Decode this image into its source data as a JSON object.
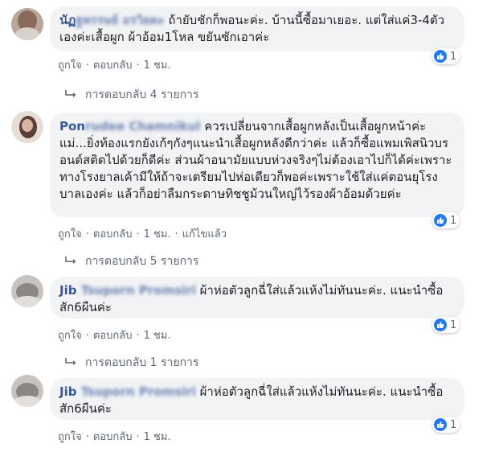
{
  "comments": [
    {
      "author_visible": "นัฏ",
      "author_blurred": "ฐพรรษย์ อรวิยดะ",
      "text": "ถ้ายับชักก็พอนะค่ะ. บ้านนี้ซื้อมาเยอะ. แต่ใส่แค่3-4ตัวเองค่ะเสื้อผูก ผ้าอ้อม1โหล ขยันซักเอาค่ะ",
      "like": "ถูกใจ",
      "reply": "ตอบกลับ",
      "time": "1 ชม.",
      "reaction_count": "1",
      "replies_label": "การตอบกลับ 4 รายการ"
    },
    {
      "author_visible": "Pon",
      "author_blurred": "rudee Chamnikul",
      "text": "ควรเปลี่ยนจากเสื้อผูกหลังเป็นเสื้อผูกหน้าค่ะแม่...ยิ่งท้องแรกยังเก้ๆกังๆแนะนำเสื้อผูกหลังดีกว่าค่ะ แล้วก็ซื้อแพมเพิสนิวบรอนต์สติดไปด้วยก็ดีค่ะ ส่วนผ้าอนามัยแบบห่วงจริงๆไม่ต้องเอาไปก็ได้ค่ะเพราะทางโรงยาลเค้ามีให้ถ้าจะเตรียมไปห่อเดียวก็พอค่ะเพราะใช้ใส่แค่ตอนยุโรงบาลเองค่ะ แล้วก็อย่าลืมกระดาษทิชชูม้วนใหญ่ไว้รองผ้าอ้อมด้วยค่ะ",
      "like": "ถูกใจ",
      "reply": "ตอบกลับ",
      "time": "1 ชม.",
      "edited": "แก้ไขแล้ว",
      "reaction_count": "1",
      "replies_label": "การตอบกลับ 5 รายการ"
    },
    {
      "author_visible": "Jib",
      "author_blurred": "Tsuporn Promsiri",
      "text": "ผ้าห่อตัวลูกฉี่ใส่แล้วแห้งไม่ทันนะค่ะ. แนะนำซื้อสัก6ผืนค่ะ",
      "like": "ถูกใจ",
      "reply": "ตอบกลับ",
      "time": "1 ชม.",
      "reaction_count": "1",
      "replies_label": "การตอบกลับ 1 รายการ"
    },
    {
      "author_visible": "Jib",
      "author_blurred": "Tsuporn Promsiri",
      "text": "ผ้าห่อตัวลูกฉี่ใส่แล้วแห้งไม่ทันนะค่ะ. แนะนำซื้อสัก6ผืนค่ะ",
      "like": "ถูกใจ",
      "reply": "ตอบกลับ",
      "time": "1 ชม.",
      "reaction_count": "1"
    }
  ],
  "colors": {
    "author": "#385898",
    "bubble": "#f2f3f5",
    "meta": "#606770",
    "like_badge": "#2078f4"
  },
  "icons": [
    "like-icon",
    "reply-arrow-icon"
  ]
}
